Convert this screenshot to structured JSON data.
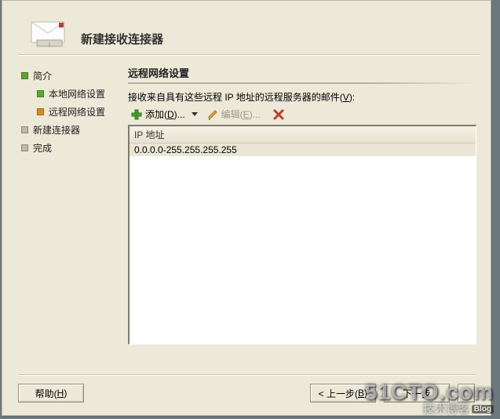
{
  "header": {
    "title": "新建接收连接器"
  },
  "nav": {
    "items": [
      {
        "label": "简介",
        "bullet": "#59a92f",
        "kind": "top"
      },
      {
        "label": "本地网络设置",
        "bullet": "#59a92f",
        "kind": "sub"
      },
      {
        "label": "远程网络设置",
        "bullet": "#d98b1a",
        "kind": "sub"
      },
      {
        "label": "新建连接器",
        "bullet": "#bcb9aa",
        "kind": "top"
      },
      {
        "label": "完成",
        "bullet": "#bcb9aa",
        "kind": "top"
      }
    ]
  },
  "main": {
    "section_title": "远程网络设置",
    "prompt_pre": "接收来自具有这些远程 IP 地址的远程服务器的邮件(",
    "prompt_key": "V",
    "prompt_post": "):",
    "toolbar": {
      "add": {
        "label_pre": "添加(",
        "key": "D",
        "label_post": ")..."
      },
      "edit": {
        "label_pre": "编辑(",
        "key": "E",
        "label_post": ")..."
      },
      "delete": {
        "name": "delete"
      }
    },
    "list": {
      "header": "IP 地址",
      "rows": [
        "0.0.0.0-255.255.255.255"
      ]
    }
  },
  "footer": {
    "help": {
      "label_pre": "帮助(",
      "key": "H",
      "label_post": ")"
    },
    "back": {
      "label_pre": "< 上一步(",
      "key": "B",
      "label_post": ")"
    },
    "next": {
      "label": "下一步"
    },
    "cancel": {
      "label": ""
    }
  },
  "watermark": {
    "line1": "51CTO.com",
    "line2": "技术博客",
    "badge": "Blog"
  }
}
